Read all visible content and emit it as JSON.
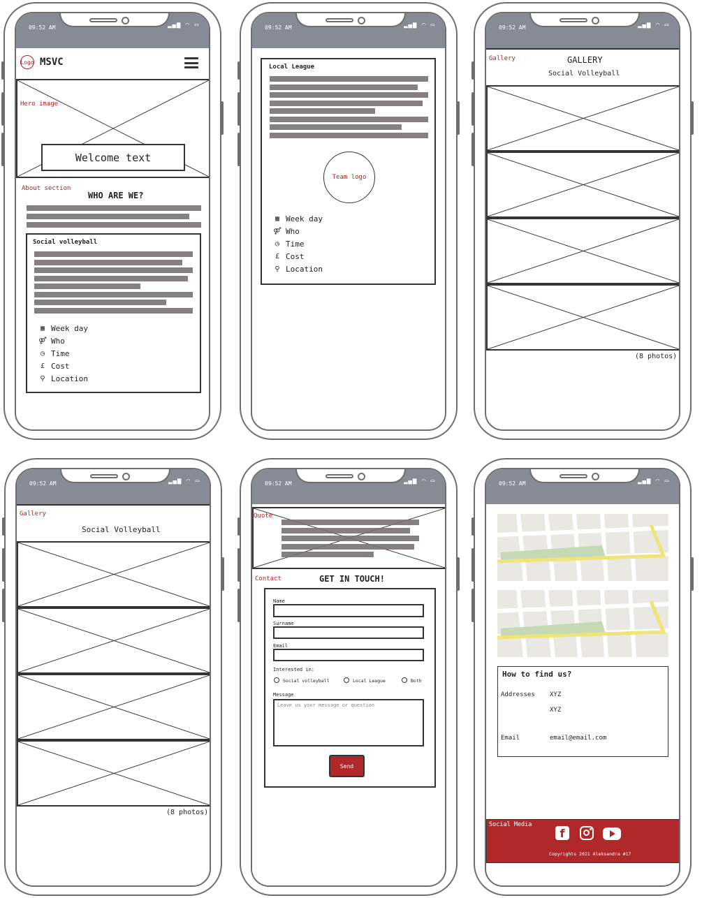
{
  "status_time": "09:52 AM",
  "phone1": {
    "logo": "Logo",
    "brand": "MSVC",
    "hero_label": "Hero image",
    "welcome": "Welcome text",
    "about_label": "About section",
    "about_title": "WHO ARE WE?",
    "card_title": "Social volleyball",
    "info": [
      "Week day",
      "Who",
      "Time",
      "Cost",
      "Location"
    ]
  },
  "phone2": {
    "card_title": "Local League",
    "team_logo": "Team logo",
    "info": [
      "Week day",
      "Who",
      "Time",
      "Cost",
      "Location"
    ]
  },
  "phone3": {
    "gallery_label": "Gallery",
    "title": "GALLERY",
    "subtitle": "Social Volleyball",
    "photo_count": "(8 photos)"
  },
  "phone4": {
    "gallery_label": "Gallery",
    "subtitle": "Social Volleyball",
    "photo_count": "(8 photos)"
  },
  "phone5": {
    "quote_label": "Quote",
    "contact_label": "Contact",
    "title": "GET IN TOUCH!",
    "name_label": "Name",
    "surname_label": "Surname",
    "email_label": "Email",
    "interested_label": "Interested in:",
    "options": [
      "Social volleyball",
      "Local League",
      "Both"
    ],
    "message_label": "Message",
    "message_placeholder": "Leave us your message or question",
    "send": "Send"
  },
  "phone6": {
    "find_title": "How to find us?",
    "addresses_label": "Addresses",
    "address1": "XYZ",
    "address2": "XYZ",
    "email_label": "Email",
    "email_value": "email@email.com",
    "social_label": "Social Media",
    "copyright": "Copyrights 2021 Aleksandra #17"
  },
  "colors": {
    "status_bar": "#868b95",
    "accent_red": "#b22222",
    "text_bar": "#867f7f",
    "footer_red": "#b0282a"
  },
  "icons": [
    "calendar-icon",
    "gender-icon",
    "clock-icon",
    "pound-icon",
    "map-pin-icon",
    "hamburger-icon",
    "facebook-icon",
    "instagram-icon",
    "youtube-icon"
  ]
}
